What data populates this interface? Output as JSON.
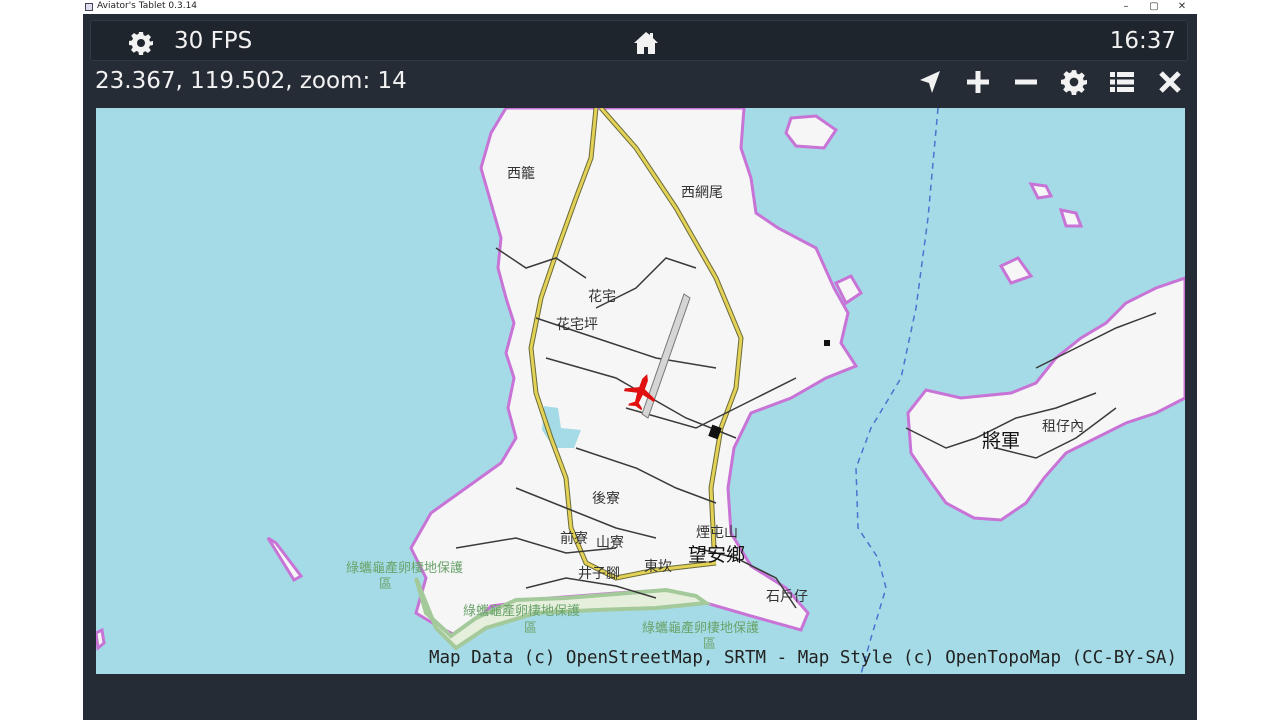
{
  "window": {
    "title": "Aviator's Tablet  0.3.14",
    "controls": [
      "–",
      "▢",
      "✕"
    ]
  },
  "topbar": {
    "fps": "30 FPS",
    "clock": "16:37",
    "icons": [
      "gear-icon",
      "home-icon"
    ]
  },
  "status": {
    "coords": "23.367, 119.502, zoom: 14"
  },
  "toolbar": {
    "icons": [
      "locate-arrow-icon",
      "zoom-in-icon",
      "zoom-out-icon",
      "settings-gear-icon",
      "list-menu-icon",
      "close-icon"
    ]
  },
  "map": {
    "attribution": "Map Data (c) OpenStreetMap, SRTM - Map Style (c) OpenTopoMap (CC-BY-SA)",
    "labels": {
      "xilong": "西籠",
      "xiwangwei": "西網尾",
      "huazhai": "花宅",
      "huazhaiping": "花宅坪",
      "houzhai": "後寮",
      "qianzhai": "前寮",
      "shanzhai": "山寮",
      "jingzijiao": "井子腳",
      "dongkan": "東坎",
      "yantunshan": "煙屯山",
      "wanganxiang": "望安鄉",
      "shihuzai": "石戶仔",
      "jiangjun": "將軍",
      "zuzainei": "租仔內",
      "turtle_reserve_1": "綠蠵龜產卵棲地保護",
      "turtle_reserve_1b": "區",
      "turtle_reserve_2": "綠蠵龜產卵棲地保護",
      "turtle_reserve_2b": "區",
      "turtle_reserve_3": "綠蠵龜產卵棲地保護",
      "turtle_reserve_3b": "區"
    }
  },
  "colors": {
    "panel": "#262c36",
    "water": "#a5dbe6",
    "land": "#f6f6f6",
    "shore": "#c873d6",
    "road": "#d8c64a",
    "aircraft": "#e01010"
  }
}
